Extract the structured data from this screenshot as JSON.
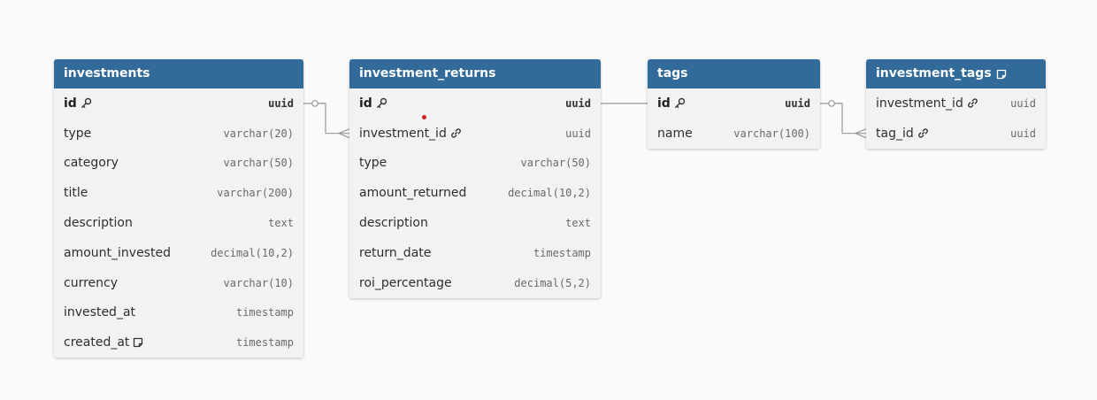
{
  "colors": {
    "header": "#326a99",
    "body": "#f2f2f2",
    "link": "#9a9a9a",
    "marker": "#d41f1f"
  },
  "tables": {
    "investments": {
      "name": "investments",
      "columns": [
        {
          "name": "id",
          "type": "uuid",
          "pk": true,
          "icon": "key-icon"
        },
        {
          "name": "type",
          "type": "varchar(20)"
        },
        {
          "name": "category",
          "type": "varchar(50)"
        },
        {
          "name": "title",
          "type": "varchar(200)"
        },
        {
          "name": "description",
          "type": "text"
        },
        {
          "name": "amount_invested",
          "type": "decimal(10,2)"
        },
        {
          "name": "currency",
          "type": "varchar(10)"
        },
        {
          "name": "invested_at",
          "type": "timestamp"
        },
        {
          "name": "created_at",
          "type": "timestamp",
          "icon": "note-icon"
        }
      ]
    },
    "investment_returns": {
      "name": "investment_returns",
      "columns": [
        {
          "name": "id",
          "type": "uuid",
          "pk": true,
          "icon": "key-icon"
        },
        {
          "name": "investment_id",
          "type": "uuid",
          "icon": "link-icon"
        },
        {
          "name": "type",
          "type": "varchar(50)"
        },
        {
          "name": "amount_returned",
          "type": "decimal(10,2)"
        },
        {
          "name": "description",
          "type": "text"
        },
        {
          "name": "return_date",
          "type": "timestamp"
        },
        {
          "name": "roi_percentage",
          "type": "decimal(5,2)"
        }
      ]
    },
    "tags": {
      "name": "tags",
      "columns": [
        {
          "name": "id",
          "type": "uuid",
          "pk": true,
          "icon": "key-icon"
        },
        {
          "name": "name",
          "type": "varchar(100)"
        }
      ]
    },
    "investment_tags": {
      "name": "investment_tags",
      "header_icon": "note-icon",
      "columns": [
        {
          "name": "investment_id",
          "type": "uuid",
          "icon": "link-icon"
        },
        {
          "name": "tag_id",
          "type": "uuid",
          "icon": "link-icon"
        }
      ]
    }
  },
  "relations": [
    {
      "from": "investments.id",
      "to": "investment_returns.investment_id",
      "from_card": "one",
      "to_card": "many"
    },
    {
      "from": "investment_returns.id",
      "to": "tags.id",
      "from_card": "none",
      "to_card": "none"
    },
    {
      "from": "tags.id",
      "to": "investment_tags.tag_id",
      "from_card": "one",
      "to_card": "many"
    }
  ]
}
